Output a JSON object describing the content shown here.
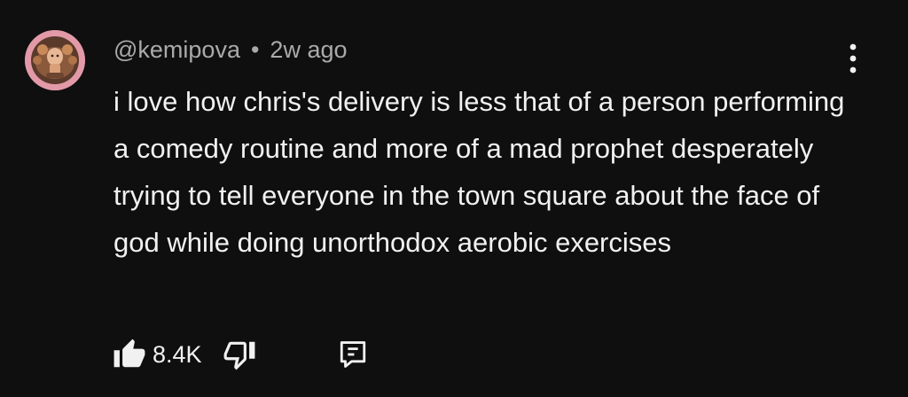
{
  "comment": {
    "author": "@kemipova",
    "separator": "•",
    "timestamp": "2w ago",
    "text": "i love how chris's delivery is less that of a person performing a comedy routine and more of a mad prophet desperately trying to tell everyone in the town square about the face of god while doing unorthodox aerobic exercises",
    "like_count": "8.4K"
  },
  "icons": {
    "avatar": "avatar-image",
    "more": "more-vert-icon",
    "like": "thumbs-up-icon",
    "dislike": "thumbs-down-icon",
    "reply": "reply-comment-icon"
  },
  "colors": {
    "background": "#0f0f0f",
    "text_primary": "#f1f1f1",
    "text_secondary": "#aaaaaa",
    "avatar_bg": "#e39aa8"
  }
}
